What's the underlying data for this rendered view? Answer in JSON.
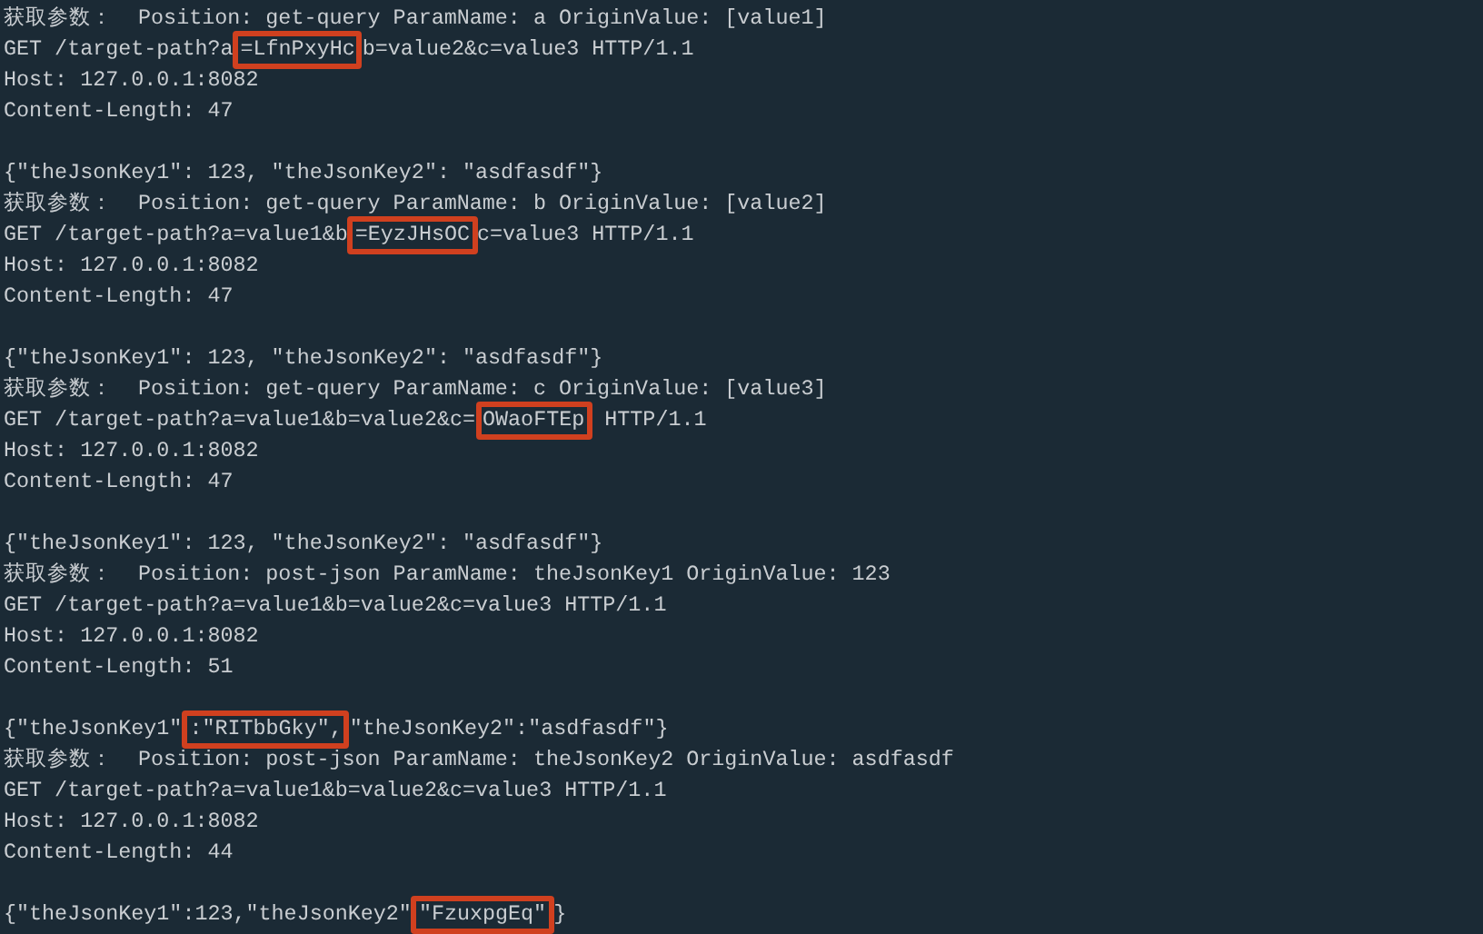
{
  "groups": [
    {
      "lines": [
        [
          {
            "text": "获取参数：  Position: get-query ParamName: a OriginValue: [value1]"
          }
        ],
        [
          {
            "text": "GET /target-path?a"
          },
          {
            "text": "=LfnPxyHc",
            "highlighted": true
          },
          {
            "text": "b=value2&c=value3 HTTP/1.1"
          }
        ],
        [
          {
            "text": "Host: 127.0.0.1:8082"
          }
        ],
        [
          {
            "text": "Content-Length: 47"
          }
        ]
      ]
    },
    {
      "lines": [
        [
          {
            "text": "{\"theJsonKey1\": 123, \"theJsonKey2\": \"asdfasdf\"}"
          }
        ],
        [
          {
            "text": "获取参数：  Position: get-query ParamName: b OriginValue: [value2]"
          }
        ],
        [
          {
            "text": "GET /target-path?a=value1&b"
          },
          {
            "text": "=EyzJHsOC",
            "highlighted": true
          },
          {
            "text": "c=value3 HTTP/1.1"
          }
        ],
        [
          {
            "text": "Host: 127.0.0.1:8082"
          }
        ],
        [
          {
            "text": "Content-Length: 47"
          }
        ]
      ]
    },
    {
      "lines": [
        [
          {
            "text": "{\"theJsonKey1\": 123, \"theJsonKey2\": \"asdfasdf\"}"
          }
        ],
        [
          {
            "text": "获取参数：  Position: get-query ParamName: c OriginValue: [value3]"
          }
        ],
        [
          {
            "text": "GET /target-path?a=value1&b=value2&c="
          },
          {
            "text": "OWaoFTEp",
            "highlighted": true
          },
          {
            "text": " HTTP/1.1"
          }
        ],
        [
          {
            "text": "Host: 127.0.0.1:8082"
          }
        ],
        [
          {
            "text": "Content-Length: 47"
          }
        ]
      ]
    },
    {
      "lines": [
        [
          {
            "text": "{\"theJsonKey1\": 123, \"theJsonKey2\": \"asdfasdf\"}"
          }
        ],
        [
          {
            "text": "获取参数：  Position: post-json ParamName: theJsonKey1 OriginValue: 123"
          }
        ],
        [
          {
            "text": "GET /target-path?a=value1&b=value2&c=value3 HTTP/1.1"
          }
        ],
        [
          {
            "text": "Host: 127.0.0.1:8082"
          }
        ],
        [
          {
            "text": "Content-Length: 51"
          }
        ]
      ]
    },
    {
      "lines": [
        [
          {
            "text": "{\"theJsonKey1\""
          },
          {
            "text": ":\"RITbbGky\",",
            "highlighted": true
          },
          {
            "text": "\"theJsonKey2\":\"asdfasdf\"}"
          }
        ],
        [
          {
            "text": "获取参数：  Position: post-json ParamName: theJsonKey2 OriginValue: asdfasdf"
          }
        ],
        [
          {
            "text": "GET /target-path?a=value1&b=value2&c=value3 HTTP/1.1"
          }
        ],
        [
          {
            "text": "Host: 127.0.0.1:8082"
          }
        ],
        [
          {
            "text": "Content-Length: 44"
          }
        ]
      ]
    },
    {
      "lines": [
        [
          {
            "text": "{\"theJsonKey1\":123,\"theJsonKey2\""
          },
          {
            "text": "\"FzuxpgEq\"",
            "highlighted": true
          },
          {
            "text": "}"
          }
        ]
      ]
    }
  ]
}
